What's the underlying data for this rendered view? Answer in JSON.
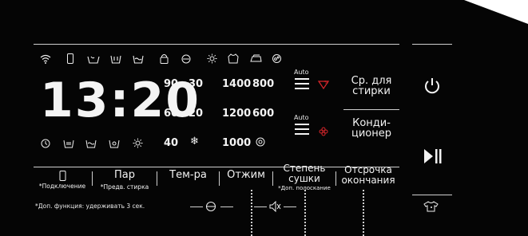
{
  "display": {
    "time": "13:20",
    "temperatures": [
      "90",
      "60",
      "40",
      "30",
      "20"
    ],
    "spins": [
      "1400",
      "800",
      "1200",
      "600",
      "1000"
    ],
    "auto_top": "Auto",
    "auto_bottom": "Auto"
  },
  "right_labels": {
    "avg_wash_line1": "Ср. для",
    "avg_wash_line2": "стирки",
    "conditioner_line1": "Конди-",
    "conditioner_line2": "ционер"
  },
  "buttons": {
    "remote_note": "*Подключение",
    "steam": "Пар",
    "steam_note": "*Предв. стирка",
    "temp": "Тем-ра",
    "spin": "Отжим",
    "dry_line1": "Степень",
    "dry_line2": "сушки",
    "dry_note": "*Доп. полоскание",
    "delay_line1": "Отсрочка",
    "delay_line2": "окончания"
  },
  "footnote": "*Доп. функция: удерживать 3 сек.",
  "accent": "#d9262b"
}
